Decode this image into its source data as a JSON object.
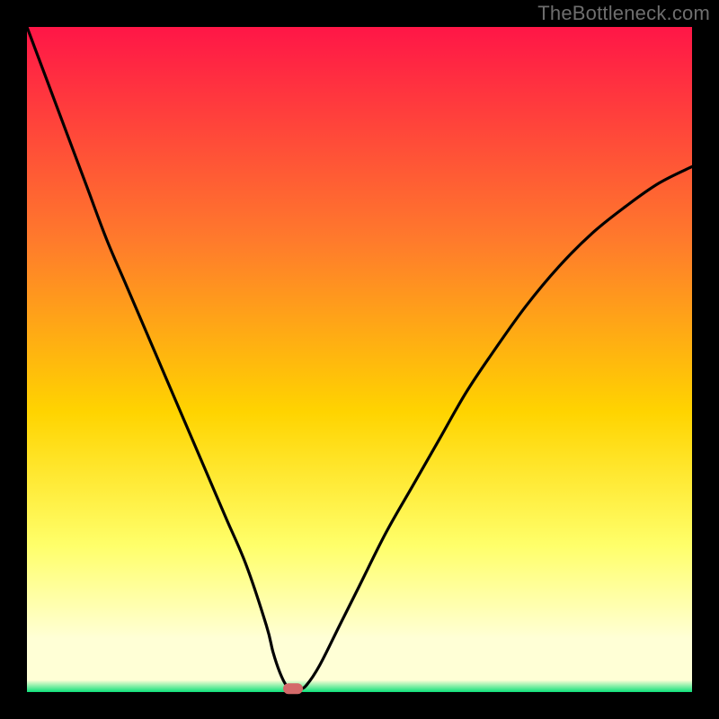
{
  "watermark": "TheBottleneck.com",
  "colors": {
    "top": "#ff1647",
    "mid_upper": "#ff7a2c",
    "mid": "#ffd400",
    "mid_lower": "#ffff6a",
    "pale": "#ffffd6",
    "green": "#0de07a",
    "curve": "#000000",
    "marker": "#d46a6a",
    "frame": "#000000"
  },
  "chart_data": {
    "type": "line",
    "title": "",
    "xlabel": "",
    "ylabel": "",
    "xlim": [
      0,
      100
    ],
    "ylim": [
      0,
      100
    ],
    "x": [
      0,
      3,
      6,
      9,
      12,
      15,
      18,
      21,
      24,
      27,
      30,
      33,
      36,
      37,
      38,
      39,
      40,
      41,
      42,
      44,
      47,
      50,
      54,
      58,
      62,
      66,
      70,
      75,
      80,
      85,
      90,
      95,
      100
    ],
    "values": [
      100,
      92,
      84,
      76,
      68,
      61,
      54,
      47,
      40,
      33,
      26,
      19,
      10,
      6,
      3,
      1,
      0.5,
      0.5,
      1,
      4,
      10,
      16,
      24,
      31,
      38,
      45,
      51,
      58,
      64,
      69,
      73,
      76.5,
      79
    ],
    "marker": {
      "x": 40,
      "y": 0.5
    },
    "annotations": []
  }
}
